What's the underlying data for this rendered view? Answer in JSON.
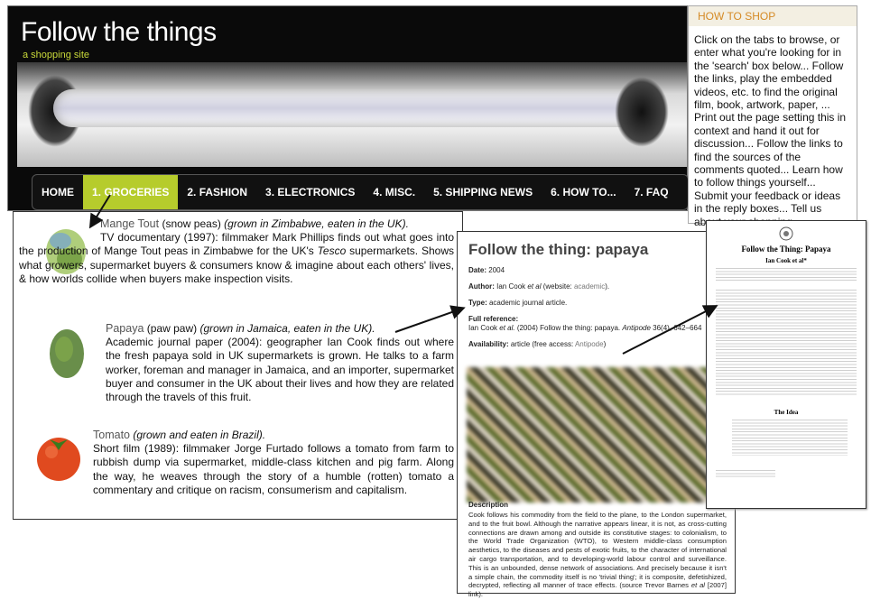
{
  "site": {
    "title": "Follow the things",
    "subtitle": "a shopping site",
    "nav": [
      "HOME",
      "1. GROCERIES",
      "2. FASHION",
      "3. ELECTRONICS",
      "4. MISC.",
      "5. SHIPPING NEWS",
      "6. HOW TO...",
      "7. FAQ"
    ],
    "active_nav": "1. GROCERIES"
  },
  "howto": {
    "heading": "HOW TO SHOP",
    "body": "Click on the tabs to browse, or enter what you're looking for in the 'search' box below... Follow the links, play the embedded videos, etc. to find the original film, book, artwork, paper, ... Print out the page setting this in context and hand it out for discussion... Follow the links to find the sources of the comments quoted... Learn how to follow things yourself... Submit your feedback or ideas in the reply boxes... Tell us about your shopping..."
  },
  "groceries": [
    {
      "title": "Mange Tout",
      "aside": "(snow peas)",
      "origin": "(grown in Zimbabwe, eaten in the UK).",
      "pre": "TV documentary (1997): filmmaker Mark Phillips finds out what goes into the production of Mange Tout peas in Zimbabwe for the UK's ",
      "em": "Tesco",
      "post": " supermarkets. Shows what growers, supermarket buyers & consumers know & imagine about each others' lives, & how worlds collide when buyers make inspection visits."
    },
    {
      "title": "Papaya",
      "aside": "(paw paw)",
      "origin": "(grown in Jamaica, eaten in the UK).",
      "pre": "Academic journal paper (2004): geographer Ian Cook finds out where the fresh papaya sold in UK supermarkets is grown. He talks to a farm worker, foreman and manager in Jamaica, and an importer, supermarket buyer and consumer in the UK about their lives and how they are related through the travels of this fruit.",
      "em": "",
      "post": ""
    },
    {
      "title": "Tomato",
      "aside": "",
      "origin": "(grown and eaten in Brazil).",
      "pre": "Short film (1989): filmmaker Jorge Furtado follows a tomato from farm to rubbish dump via supermarket, middle-class kitchen and pig farm. Along the way, he weaves through the story of a humble (rotten) tomato a commentary and critique on racism, consumerism and capitalism.",
      "em": "",
      "post": ""
    }
  ],
  "detail": {
    "title": "Follow the thing: papaya",
    "date_label": "Date:",
    "date": "2004",
    "author_label": "Author:",
    "author": "Ian Cook ",
    "author_etal": "et al",
    "author_site": " (website: ",
    "author_site_link": "academic",
    "author_site_end": ").",
    "type_label": "Type:",
    "type": "academic journal article.",
    "ref_label": "Full reference:",
    "ref_a": "Ian Cook ",
    "ref_etal": "et al.",
    "ref_b": " (2004) Follow the thing: papaya. ",
    "ref_journal": "Antipode",
    "ref_c": " 36(4), 642–664",
    "avail_label": "Availability:",
    "avail_a": " article (free access: ",
    "avail_link": "Antipode",
    "avail_b": ")",
    "desc_label": "Description",
    "desc": "Cook follows his commodity from the field to the plane, to the London supermarket, and to the fruit bowl. Although the narrative appears linear, it is not, as cross-cutting connections are drawn among and outside its constitutive stages: to colonialism, to the World Trade Organization (WTO), to Western middle-class consumption aesthetics, to the diseases and pests of exotic fruits, to the character of international air cargo transportation, and to developing-world labour control and surveillance. This is an unbounded, dense network of associations. And precisely because it isn't a simple chain, the commodity itself is no 'trivial thing'; it is composite, defetishized, decrypted, reflecting all manner of trace effects. (source Trevor Barnes ",
    "desc_etal": "et al",
    "desc_end": " [2007] link)."
  },
  "paper": {
    "title": "Follow the Thing: Papaya",
    "author": "Ian Cook et al*",
    "section": "The Idea"
  },
  "colors": {
    "accent_green": "#b6cc2c",
    "howto_orange": "#d58a25"
  }
}
